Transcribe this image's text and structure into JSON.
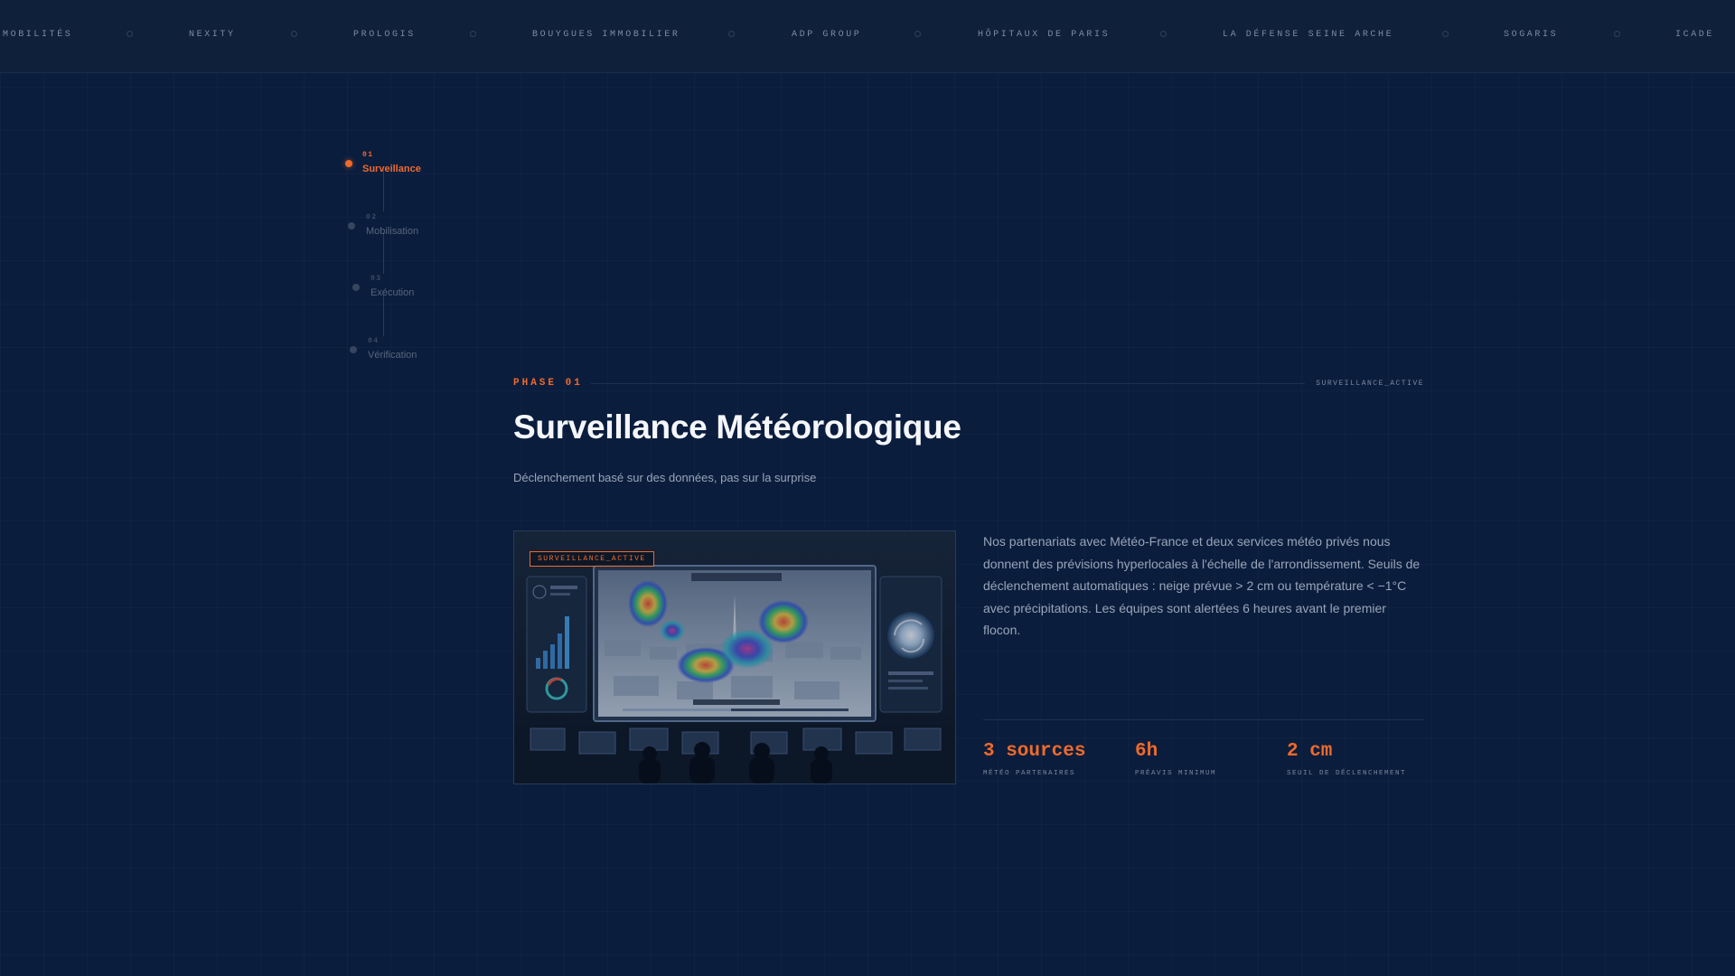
{
  "partners": [
    "MOBILITÉS",
    "NEXITY",
    "PROLOGIS",
    "BOUYGUES IMMOBILIER",
    "ADP GROUP",
    "HÔPITAUX DE PARIS",
    "LA DÉFENSE SEINE ARCHE",
    "SOGARIS",
    "ICADE"
  ],
  "timeline": [
    {
      "num": "01",
      "label": "Surveillance",
      "active": true
    },
    {
      "num": "02",
      "label": "Mobilisation",
      "active": false
    },
    {
      "num": "03",
      "label": "Exécution",
      "active": false
    },
    {
      "num": "04",
      "label": "Vérification",
      "active": false
    }
  ],
  "phase": {
    "label": "PHASE 01",
    "status": "SURVEILLANCE_ACTIVE",
    "title": "Surveillance Météorologique",
    "subtitle": "Déclenchement basé sur des données, pas sur la surprise",
    "image_badge": "SURVEILLANCE_ACTIVE",
    "description": "Nos partenariats avec Météo-France et deux services météo privés nous donnent des prévisions hyperlocales à l'échelle de l'arrondissement. Seuils de déclenchement automatiques : neige prévue > 2 cm ou température < −1°C avec précipitations. Les équipes sont alertées 6 heures avant le premier flocon."
  },
  "stats": [
    {
      "value": "3 sources",
      "label": "MÉTÉO PARTENAIRES"
    },
    {
      "value": "6h",
      "label": "PRÉAVIS MINIMUM"
    },
    {
      "value": "2 cm",
      "label": "SEUIL DE DÉCLENCHEMENT"
    }
  ],
  "colors": {
    "accent": "#ef6a2b",
    "background": "#0b1d3d",
    "marquee_bg": "#0f203a",
    "text_primary": "#f4f6fa",
    "text_muted": "#98a5b8"
  }
}
